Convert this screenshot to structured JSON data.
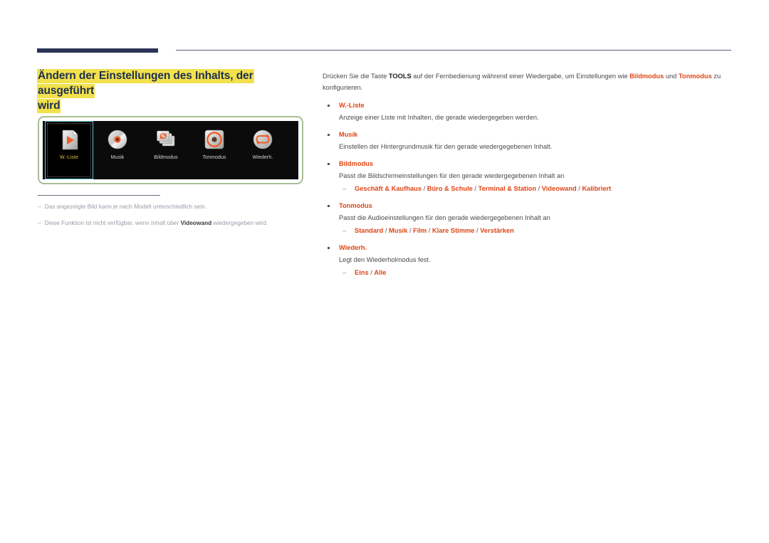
{
  "page": {
    "title_line1": "Ändern der Einstellungen des Inhalts, der ausgeführt",
    "title_line2": "wird"
  },
  "device_panel": {
    "tiles": [
      {
        "label": "W.-Liste",
        "icon": "playlist-file-icon",
        "selected": true
      },
      {
        "label": "Musik",
        "icon": "music-disc-icon",
        "selected": false
      },
      {
        "label": "Bildmodus",
        "icon": "picture-mode-refresh-icon",
        "selected": false
      },
      {
        "label": "Tonmodus",
        "icon": "sound-mode-knob-icon",
        "selected": false
      },
      {
        "label": "Wiederh.",
        "icon": "repeat-loop-icon",
        "selected": false
      }
    ]
  },
  "notes": [
    {
      "dash": "–",
      "text_before": "Das angezeigte Bild kann je nach Modell unterschiedlich sein.",
      "bold": "",
      "text_after": ""
    },
    {
      "dash": "–",
      "text_before": "Diese Funktion ist nicht verfügbar, wenn Inhalt über ",
      "bold": "Videowand",
      "text_after": " wiedergegeben wird."
    }
  ],
  "intro": {
    "p1": "Drücken Sie die Taste ",
    "tools": "TOOLS",
    "p2": " auf der Fernbedienung während einer Wiedergabe, um Einstellungen wie ",
    "kw1": "Bildmodus",
    "p3": " und ",
    "kw2": "Tonmodus",
    "p4": " zu konfigurieren."
  },
  "items": [
    {
      "title": "W.-Liste",
      "desc": "Anzeige einer Liste mit Inhalten, die gerade wiedergegeben werden.",
      "options": []
    },
    {
      "title": "Musik",
      "desc": "Einstellen der Hintergrundmusik für den gerade wiedergegebenen Inhalt.",
      "options": []
    },
    {
      "title": "Bildmodus",
      "desc": "Passt die Bildschirmeinstellungen für den gerade wiedergegebenen Inhalt an",
      "options": [
        "Geschäft & Kaufhaus",
        "Büro & Schule",
        "Terminal & Station",
        "Videowand",
        "Kalibriert"
      ]
    },
    {
      "title": "Tonmodus",
      "desc": "Passt die Audioeinstellungen für den gerade wiedergegebenen Inhalt an",
      "options": [
        "Standard",
        "Musik",
        "Film",
        "Klare Stimme",
        "Verstärken"
      ]
    },
    {
      "title": "Wiederh.",
      "desc": "Legt den Wiederholmodus fest.",
      "options": [
        "Eins",
        "Alle"
      ]
    }
  ],
  "colors": {
    "accent_orange": "#e04413",
    "title_navy": "#20304f",
    "highlight_yellow": "#f2e14c",
    "frame_green": "#a9bd94",
    "selection_cyan": "#61c8d6",
    "selected_label_yellow": "#d9c33d"
  }
}
